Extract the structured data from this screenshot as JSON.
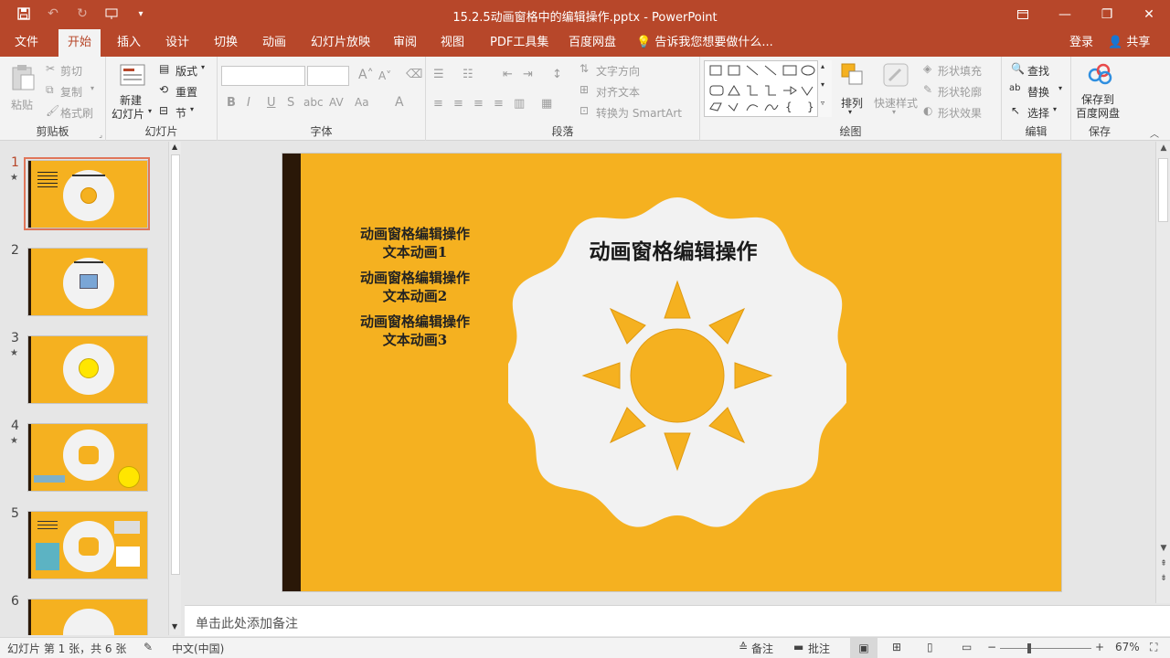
{
  "app": {
    "title": "15.2.5动画窗格中的编辑操作.pptx - PowerPoint",
    "accent": "#b7472a"
  },
  "tabs": [
    {
      "label": "文件"
    },
    {
      "label": "开始",
      "active": true
    },
    {
      "label": "插入"
    },
    {
      "label": "设计"
    },
    {
      "label": "切换"
    },
    {
      "label": "动画"
    },
    {
      "label": "幻灯片放映"
    },
    {
      "label": "审阅"
    },
    {
      "label": "视图"
    },
    {
      "label": "PDF工具集"
    },
    {
      "label": "百度网盘"
    }
  ],
  "tell_me": "告诉我您想要做什么...",
  "sign_in": "登录",
  "share": "共享",
  "ribbon": {
    "clipboard": {
      "label": "剪贴板",
      "paste": "粘贴",
      "cut": "剪切",
      "copy": "复制",
      "format_painter": "格式刷"
    },
    "slides": {
      "label": "幻灯片",
      "new_slide_1": "新建",
      "new_slide_2": "幻灯片",
      "layout": "版式",
      "reset": "重置",
      "section": "节"
    },
    "font": {
      "label": "字体"
    },
    "paragraph": {
      "label": "段落",
      "text_direction": "文字方向",
      "align_text": "对齐文本",
      "smartart": "转换为 SmartArt"
    },
    "drawing": {
      "label": "绘图",
      "arrange": "排列",
      "quick_styles": "快速样式",
      "shape_fill": "形状填充",
      "shape_outline": "形状轮廓",
      "shape_effects": "形状效果"
    },
    "editing": {
      "label": "编辑",
      "find": "查找",
      "replace": "替换",
      "select": "选择"
    },
    "save": {
      "label": "保存",
      "save_to_1": "保存到",
      "save_to_2": "百度网盘"
    }
  },
  "thumbnails": [
    {
      "num": "1",
      "star": true,
      "selected": true
    },
    {
      "num": "2",
      "star": false
    },
    {
      "num": "3",
      "star": true
    },
    {
      "num": "4",
      "star": true
    },
    {
      "num": "5",
      "star": false
    },
    {
      "num": "6",
      "star": false
    }
  ],
  "slide": {
    "title": "动画窗格编辑操作",
    "items": [
      {
        "line1": "动画窗格编辑操作",
        "line2": "文本动画1"
      },
      {
        "line1": "动画窗格编辑操作",
        "line2": "文本动画2"
      },
      {
        "line1": "动画窗格编辑操作",
        "line2": "文本动画3"
      }
    ],
    "bg_color": "#f5b120",
    "sun_color": "#f5b120"
  },
  "notes_placeholder": "单击此处添加备注",
  "status": {
    "slide_info": "幻灯片 第 1 张，共 6 张",
    "language": "中文(中国)",
    "notes": "备注",
    "comments": "批注",
    "zoom": "67%"
  }
}
